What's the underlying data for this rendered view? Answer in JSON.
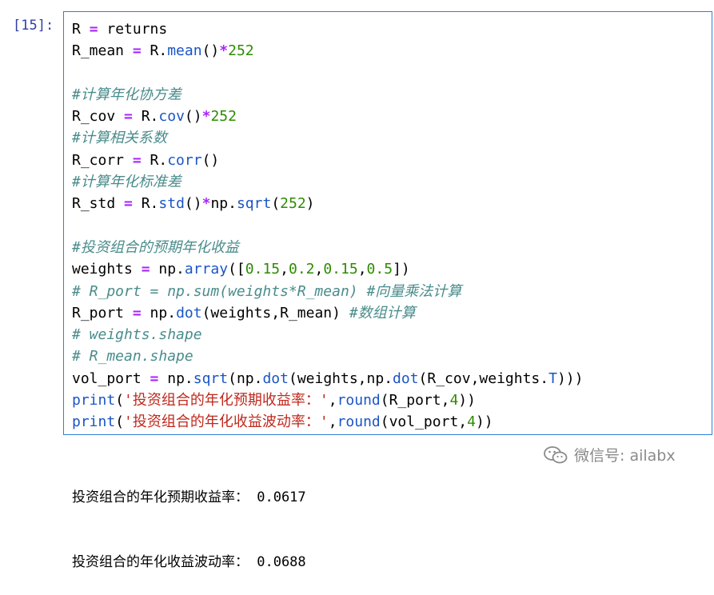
{
  "cell": {
    "prompt": "[15]:",
    "lines": [
      [
        {
          "t": "R "
        },
        {
          "t": "=",
          "c": "op"
        },
        {
          "t": " returns"
        }
      ],
      [
        {
          "t": "R_mean "
        },
        {
          "t": "=",
          "c": "op"
        },
        {
          "t": " R."
        },
        {
          "t": "mean",
          "c": "attr"
        },
        {
          "t": "()"
        },
        {
          "t": "*",
          "c": "op"
        },
        {
          "t": "252",
          "c": "num"
        }
      ],
      [],
      [
        {
          "t": "#计算年化协方差",
          "c": "cmt"
        }
      ],
      [
        {
          "t": "R_cov "
        },
        {
          "t": "=",
          "c": "op"
        },
        {
          "t": " R."
        },
        {
          "t": "cov",
          "c": "attr"
        },
        {
          "t": "()"
        },
        {
          "t": "*",
          "c": "op"
        },
        {
          "t": "252",
          "c": "num"
        }
      ],
      [
        {
          "t": "#计算相关系数",
          "c": "cmt"
        }
      ],
      [
        {
          "t": "R_corr "
        },
        {
          "t": "=",
          "c": "op"
        },
        {
          "t": " R."
        },
        {
          "t": "corr",
          "c": "attr"
        },
        {
          "t": "()"
        }
      ],
      [
        {
          "t": "#计算年化标准差",
          "c": "cmt"
        }
      ],
      [
        {
          "t": "R_std "
        },
        {
          "t": "=",
          "c": "op"
        },
        {
          "t": " R."
        },
        {
          "t": "std",
          "c": "attr"
        },
        {
          "t": "()"
        },
        {
          "t": "*",
          "c": "op"
        },
        {
          "t": "np."
        },
        {
          "t": "sqrt",
          "c": "attr"
        },
        {
          "t": "("
        },
        {
          "t": "252",
          "c": "num"
        },
        {
          "t": ")"
        }
      ],
      [],
      [
        {
          "t": "#投资组合的预期年化收益",
          "c": "cmt"
        }
      ],
      [
        {
          "t": "weights "
        },
        {
          "t": "=",
          "c": "op"
        },
        {
          "t": " np."
        },
        {
          "t": "array",
          "c": "attr"
        },
        {
          "t": "(["
        },
        {
          "t": "0.15",
          "c": "num"
        },
        {
          "t": ","
        },
        {
          "t": "0.2",
          "c": "num"
        },
        {
          "t": ","
        },
        {
          "t": "0.15",
          "c": "num"
        },
        {
          "t": ","
        },
        {
          "t": "0.5",
          "c": "num"
        },
        {
          "t": "])"
        }
      ],
      [
        {
          "t": "# R_port = np.sum(weights*R_mean) #向量乘法计算",
          "c": "cmt"
        }
      ],
      [
        {
          "t": "R_port "
        },
        {
          "t": "=",
          "c": "op"
        },
        {
          "t": " np."
        },
        {
          "t": "dot",
          "c": "attr"
        },
        {
          "t": "(weights,R_mean) "
        },
        {
          "t": "#数组计算",
          "c": "cmt"
        }
      ],
      [
        {
          "t": "# weights.shape",
          "c": "cmt"
        }
      ],
      [
        {
          "t": "# R_mean.shape",
          "c": "cmt"
        }
      ],
      [
        {
          "t": "vol_port "
        },
        {
          "t": "=",
          "c": "op"
        },
        {
          "t": " np."
        },
        {
          "t": "sqrt",
          "c": "attr"
        },
        {
          "t": "(np."
        },
        {
          "t": "dot",
          "c": "attr"
        },
        {
          "t": "(weights,np."
        },
        {
          "t": "dot",
          "c": "attr"
        },
        {
          "t": "(R_cov,weights."
        },
        {
          "t": "T",
          "c": "attr"
        },
        {
          "t": ")))"
        }
      ],
      [
        {
          "t": "print",
          "c": "attr"
        },
        {
          "t": "("
        },
        {
          "t": "'投资组合的年化预期收益率：'",
          "c": "str"
        },
        {
          "t": ","
        },
        {
          "t": "round",
          "c": "attr"
        },
        {
          "t": "(R_port,"
        },
        {
          "t": "4",
          "c": "num"
        },
        {
          "t": "))"
        }
      ],
      [
        {
          "t": "print",
          "c": "attr"
        },
        {
          "t": "("
        },
        {
          "t": "'投资组合的年化收益波动率：'",
          "c": "str"
        },
        {
          "t": ","
        },
        {
          "t": "round",
          "c": "attr"
        },
        {
          "t": "(vol_port,"
        },
        {
          "t": "4",
          "c": "num"
        },
        {
          "t": "))"
        }
      ]
    ]
  },
  "output": {
    "lines": [
      "投资组合的年化预期收益率： 0.0617",
      "投资组合的年化收益波动率： 0.0688"
    ]
  },
  "watermark": {
    "text": "微信号: ailabx",
    "icon": "wechat-icon"
  },
  "colors": {
    "cell_border": "#2f7fd8",
    "prompt": "#303f9f",
    "operator": "#aa22ff",
    "attribute": "#1a55c6",
    "number": "#2e8b00",
    "comment": "#4a8c8c",
    "string": "#c0281d"
  }
}
